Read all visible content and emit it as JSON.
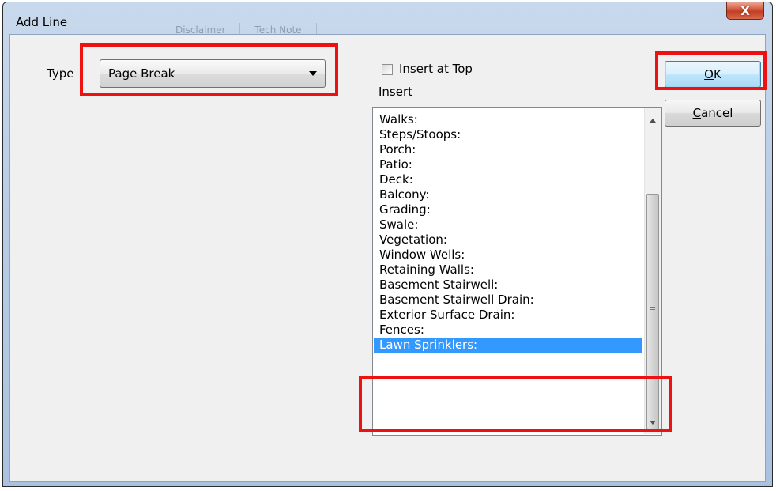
{
  "window": {
    "title": "Add Line",
    "close_glyph": "X",
    "ghost_tabs": [
      "Disclaimer",
      "Tech Note"
    ]
  },
  "form": {
    "type_label": "Type",
    "type_value": "Page Break",
    "insert_at_top_label": "Insert at Top",
    "insert_at_top_checked": false,
    "insert_label": "Insert"
  },
  "insert_list": {
    "items": [
      "Walks:",
      "Steps/Stoops:",
      "Porch:",
      "Patio:",
      "Deck:",
      "Balcony:",
      "Grading:",
      "Swale:",
      "Vegetation:",
      "Window Wells:",
      "Retaining Walls:",
      "Basement Stairwell:",
      "Basement Stairwell Drain:",
      "Exterior Surface Drain:",
      "Fences:",
      "Lawn Sprinklers:"
    ],
    "selected": "Lawn Sprinklers:"
  },
  "buttons": {
    "ok_accel": "O",
    "ok_rest": "K",
    "cancel_accel": "C",
    "cancel_rest": "ancel"
  },
  "colors": {
    "highlight": "#ee1111",
    "selection": "#3399ff"
  }
}
